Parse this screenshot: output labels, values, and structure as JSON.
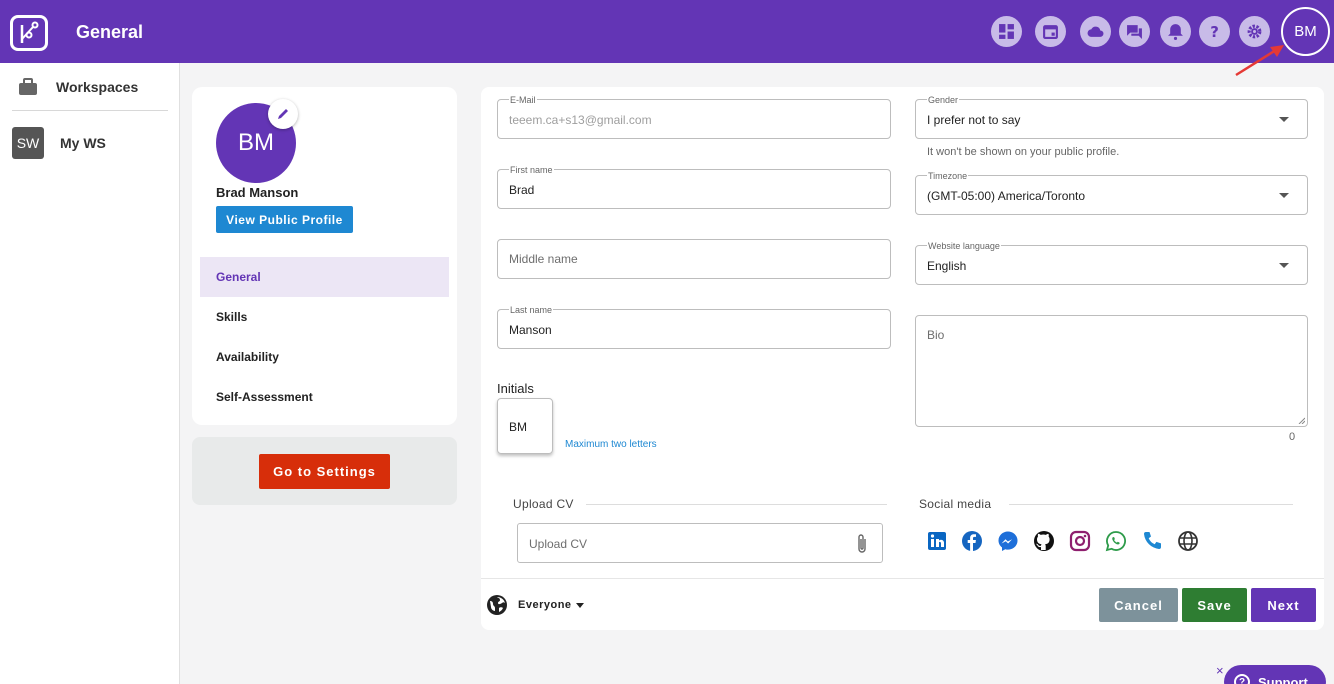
{
  "header": {
    "title": "General",
    "avatar_initials": "BM"
  },
  "top_icons": [
    "dashboard-icon",
    "calendar-icon",
    "cloud-icon",
    "chat-icon",
    "bell-icon",
    "help-icon",
    "gear-icon"
  ],
  "sidebar": {
    "workspaces_label": "Workspaces",
    "items": [
      {
        "badge": "SW",
        "label": "My WS"
      }
    ]
  },
  "profile": {
    "avatar_initials": "BM",
    "name": "Brad Manson",
    "view_public_label": "View Public Profile",
    "menu": [
      "General",
      "Skills",
      "Availability",
      "Self-Assessment"
    ],
    "active_menu": "General",
    "settings_button": "Go to Settings"
  },
  "form": {
    "email": {
      "label": "E-Mail",
      "value": "teeem.ca+s13@gmail.com"
    },
    "first_name": {
      "label": "First name",
      "value": "Brad"
    },
    "middle_name": {
      "placeholder": "Middle name"
    },
    "last_name": {
      "label": "Last name",
      "value": "Manson"
    },
    "initials": {
      "label": "Initials",
      "value": "BM",
      "hint": "Maximum two letters"
    },
    "gender": {
      "label": "Gender",
      "value": "I prefer not to say",
      "helper": "It won't be shown on your public profile."
    },
    "timezone": {
      "label": "Timezone",
      "value": "(GMT-05:00) America/Toronto"
    },
    "language": {
      "label": "Website language",
      "value": "English"
    },
    "bio": {
      "placeholder": "Bio",
      "count": "0"
    },
    "upload_cv": {
      "section_title": "Upload CV",
      "placeholder": "Upload CV"
    },
    "social": {
      "section_title": "Social media"
    }
  },
  "footer": {
    "visibility": "Everyone",
    "cancel": "Cancel",
    "save": "Save",
    "next": "Next"
  },
  "support": {
    "label": "Support",
    "close": "×"
  },
  "colors": {
    "brand": "#6335b5",
    "primary_blue": "#1e88d2",
    "danger": "#d72e0a",
    "cancel": "#7d929b",
    "save": "#2e7d32"
  }
}
